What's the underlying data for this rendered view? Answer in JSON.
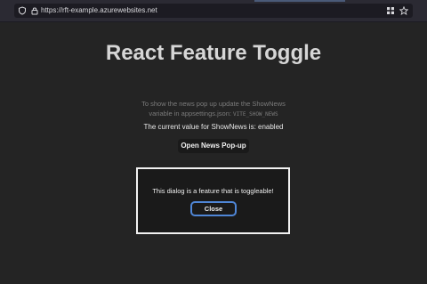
{
  "browser": {
    "url": "https://rft-example.azurewebsites.net",
    "icons": [
      "shield-icon",
      "lock-icon",
      "grid-icon",
      "star-icon"
    ]
  },
  "page": {
    "title": "React Feature Toggle",
    "description_prefix": "To show the news pop up update the ShowNews variable in appsettings.json: ",
    "description_code": "VITE_SHOW_NEWS",
    "current_value_line": "The current value for ShowNews is: enabled",
    "open_button_label": "Open News Pop-up"
  },
  "dialog": {
    "message": "This dialog is a feature that is toggleable!",
    "close_label": "Close"
  },
  "colors": {
    "background": "#242424",
    "dialog_border": "#f2f2f2",
    "focus_ring": "#4f86d6"
  }
}
